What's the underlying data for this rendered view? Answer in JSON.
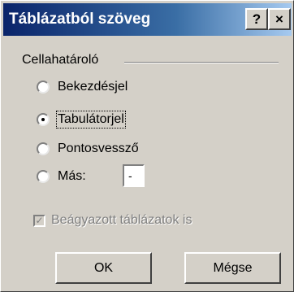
{
  "window": {
    "title": "Táblázatból szöveg",
    "help_label": "?",
    "close_label": "×"
  },
  "group": {
    "label": "Cellahatároló"
  },
  "options": [
    {
      "label": "Bekezdésjel",
      "selected": false
    },
    {
      "label": "Tabulátorjel",
      "selected": true
    },
    {
      "label": "Pontosvessző",
      "selected": false
    },
    {
      "label": "Más:",
      "selected": false
    }
  ],
  "other_input": {
    "value": "-"
  },
  "nested_tables": {
    "label": "Beágyazott táblázatok is",
    "checked": true,
    "disabled": true
  },
  "buttons": {
    "ok_label": "OK",
    "cancel_label": "Mégse"
  }
}
